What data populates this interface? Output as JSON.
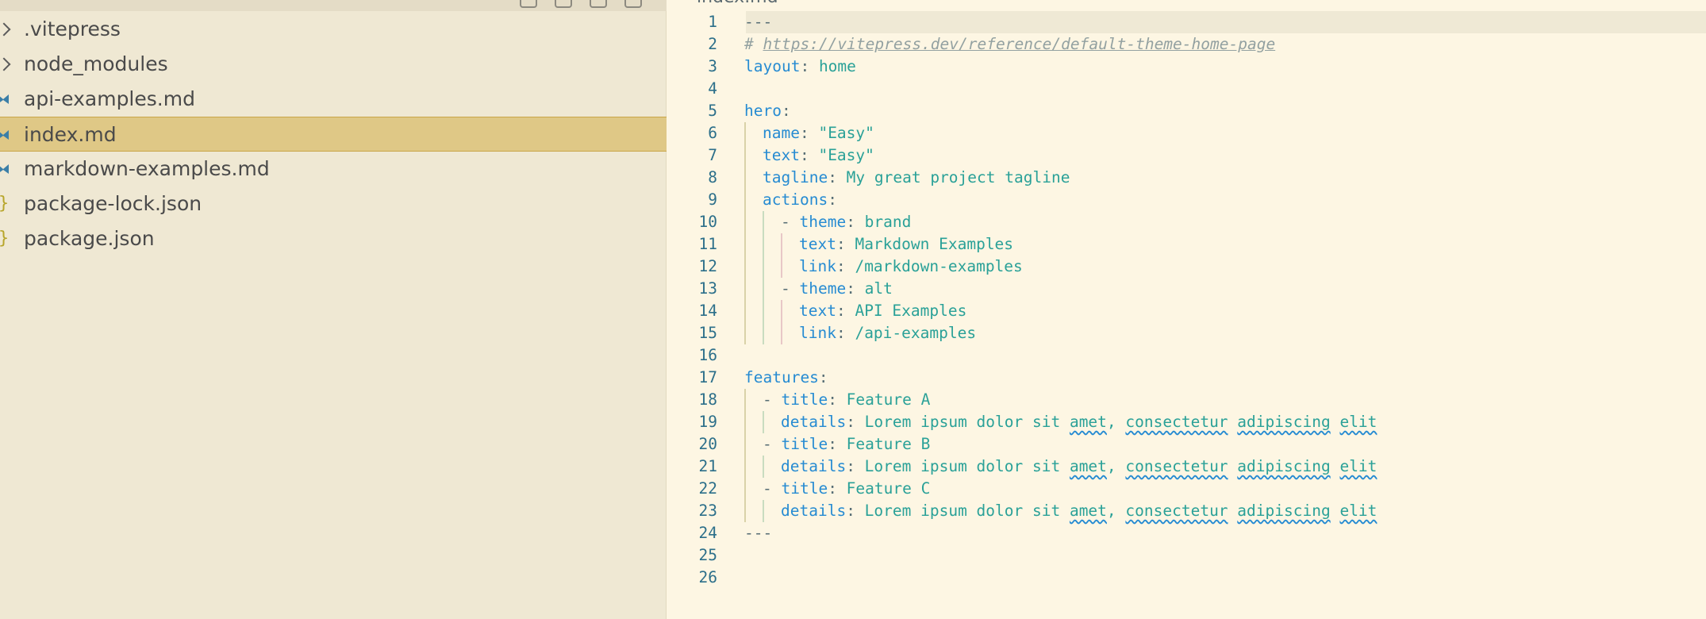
{
  "editor": {
    "tab_name": "index.md",
    "lines": [
      {
        "n": "1",
        "indent": 0,
        "parts": [
          {
            "t": "---",
            "c": "p"
          }
        ]
      },
      {
        "n": "2",
        "indent": 0,
        "parts": [
          {
            "t": "# ",
            "c": "c"
          },
          {
            "t": "https://vitepress.dev/reference/default-theme-home-page",
            "c": "c u"
          }
        ]
      },
      {
        "n": "3",
        "indent": 0,
        "parts": [
          {
            "t": "layout",
            "c": "k"
          },
          {
            "t": ": ",
            "c": "p"
          },
          {
            "t": "home",
            "c": "s"
          }
        ]
      },
      {
        "n": "4",
        "indent": 0,
        "parts": []
      },
      {
        "n": "5",
        "indent": 0,
        "parts": [
          {
            "t": "hero",
            "c": "k"
          },
          {
            "t": ":",
            "c": "p"
          }
        ]
      },
      {
        "n": "6",
        "indent": 1,
        "parts": [
          {
            "t": "name",
            "c": "k"
          },
          {
            "t": ": ",
            "c": "p"
          },
          {
            "t": "\"Easy\"",
            "c": "s"
          }
        ]
      },
      {
        "n": "7",
        "indent": 1,
        "parts": [
          {
            "t": "text",
            "c": "k"
          },
          {
            "t": ": ",
            "c": "p"
          },
          {
            "t": "\"Easy\"",
            "c": "s"
          }
        ]
      },
      {
        "n": "8",
        "indent": 1,
        "parts": [
          {
            "t": "tagline",
            "c": "k"
          },
          {
            "t": ": ",
            "c": "p"
          },
          {
            "t": "My great project tagline",
            "c": "s"
          }
        ]
      },
      {
        "n": "9",
        "indent": 1,
        "parts": [
          {
            "t": "actions",
            "c": "k"
          },
          {
            "t": ":",
            "c": "p"
          }
        ]
      },
      {
        "n": "10",
        "indent": 2,
        "parts": [
          {
            "t": "- ",
            "c": "p"
          },
          {
            "t": "theme",
            "c": "k"
          },
          {
            "t": ": ",
            "c": "p"
          },
          {
            "t": "brand",
            "c": "s"
          }
        ]
      },
      {
        "n": "11",
        "indent": 3,
        "parts": [
          {
            "t": "text",
            "c": "k"
          },
          {
            "t": ": ",
            "c": "p"
          },
          {
            "t": "Markdown Examples",
            "c": "s"
          }
        ]
      },
      {
        "n": "12",
        "indent": 3,
        "parts": [
          {
            "t": "link",
            "c": "k"
          },
          {
            "t": ": ",
            "c": "p"
          },
          {
            "t": "/markdown-examples",
            "c": "s"
          }
        ]
      },
      {
        "n": "13",
        "indent": 2,
        "parts": [
          {
            "t": "- ",
            "c": "p"
          },
          {
            "t": "theme",
            "c": "k"
          },
          {
            "t": ": ",
            "c": "p"
          },
          {
            "t": "alt",
            "c": "s"
          }
        ]
      },
      {
        "n": "14",
        "indent": 3,
        "parts": [
          {
            "t": "text",
            "c": "k"
          },
          {
            "t": ": ",
            "c": "p"
          },
          {
            "t": "API Examples",
            "c": "s"
          }
        ]
      },
      {
        "n": "15",
        "indent": 3,
        "parts": [
          {
            "t": "link",
            "c": "k"
          },
          {
            "t": ": ",
            "c": "p"
          },
          {
            "t": "/api-examples",
            "c": "s"
          }
        ]
      },
      {
        "n": "16",
        "indent": 0,
        "parts": []
      },
      {
        "n": "17",
        "indent": 0,
        "parts": [
          {
            "t": "features",
            "c": "k"
          },
          {
            "t": ":",
            "c": "p"
          }
        ]
      },
      {
        "n": "18",
        "indent": 1,
        "parts": [
          {
            "t": "- ",
            "c": "p"
          },
          {
            "t": "title",
            "c": "k"
          },
          {
            "t": ": ",
            "c": "p"
          },
          {
            "t": "Feature A",
            "c": "s"
          }
        ]
      },
      {
        "n": "19",
        "indent": 2,
        "parts": [
          {
            "t": "details",
            "c": "k"
          },
          {
            "t": ": ",
            "c": "p"
          },
          {
            "t": "Lorem ipsum dolor sit ",
            "c": "s"
          },
          {
            "t": "amet",
            "c": "s sq"
          },
          {
            "t": ", ",
            "c": "s"
          },
          {
            "t": "consectetur",
            "c": "s sq"
          },
          {
            "t": " ",
            "c": "s"
          },
          {
            "t": "adipiscing",
            "c": "s sq"
          },
          {
            "t": " ",
            "c": "s"
          },
          {
            "t": "elit",
            "c": "s sq"
          }
        ]
      },
      {
        "n": "20",
        "indent": 1,
        "parts": [
          {
            "t": "- ",
            "c": "p"
          },
          {
            "t": "title",
            "c": "k"
          },
          {
            "t": ": ",
            "c": "p"
          },
          {
            "t": "Feature B",
            "c": "s"
          }
        ]
      },
      {
        "n": "21",
        "indent": 2,
        "parts": [
          {
            "t": "details",
            "c": "k"
          },
          {
            "t": ": ",
            "c": "p"
          },
          {
            "t": "Lorem ipsum dolor sit ",
            "c": "s"
          },
          {
            "t": "amet",
            "c": "s sq"
          },
          {
            "t": ", ",
            "c": "s"
          },
          {
            "t": "consectetur",
            "c": "s sq"
          },
          {
            "t": " ",
            "c": "s"
          },
          {
            "t": "adipiscing",
            "c": "s sq"
          },
          {
            "t": " ",
            "c": "s"
          },
          {
            "t": "elit",
            "c": "s sq"
          }
        ]
      },
      {
        "n": "22",
        "indent": 1,
        "parts": [
          {
            "t": "- ",
            "c": "p"
          },
          {
            "t": "title",
            "c": "k"
          },
          {
            "t": ": ",
            "c": "p"
          },
          {
            "t": "Feature C",
            "c": "s"
          }
        ]
      },
      {
        "n": "23",
        "indent": 2,
        "parts": [
          {
            "t": "details",
            "c": "k"
          },
          {
            "t": ": ",
            "c": "p"
          },
          {
            "t": "Lorem ipsum dolor sit ",
            "c": "s"
          },
          {
            "t": "amet",
            "c": "s sq"
          },
          {
            "t": ", ",
            "c": "s"
          },
          {
            "t": "consectetur",
            "c": "s sq"
          },
          {
            "t": " ",
            "c": "s"
          },
          {
            "t": "adipiscing",
            "c": "s sq"
          },
          {
            "t": " ",
            "c": "s"
          },
          {
            "t": "elit",
            "c": "s sq"
          }
        ]
      },
      {
        "n": "24",
        "indent": 0,
        "parts": [
          {
            "t": "---",
            "c": "p"
          }
        ]
      },
      {
        "n": "25",
        "indent": 0,
        "parts": []
      },
      {
        "n": "26",
        "indent": 0,
        "parts": []
      }
    ]
  },
  "explorer": {
    "items": [
      {
        "label": ".vitepress",
        "icon": "chevron-right-icon",
        "selected": false
      },
      {
        "label": "node_modules",
        "icon": "chevron-right-icon",
        "selected": false
      },
      {
        "label": "api-examples.md",
        "icon": "markdown-icon",
        "selected": false
      },
      {
        "label": "index.md",
        "icon": "markdown-icon",
        "selected": true
      },
      {
        "label": "markdown-examples.md",
        "icon": "markdown-icon",
        "selected": false
      },
      {
        "label": "package-lock.json",
        "icon": "json-icon",
        "selected": false
      },
      {
        "label": "package.json",
        "icon": "json-icon",
        "selected": false
      }
    ]
  },
  "colors": {
    "sidebar_bg": "#efe8d3",
    "editor_bg": "#fdf6e3",
    "selected_bg": "#dfc886",
    "key": "#268bd2",
    "value": "#2aa198",
    "line_number": "#2c6f8a"
  }
}
